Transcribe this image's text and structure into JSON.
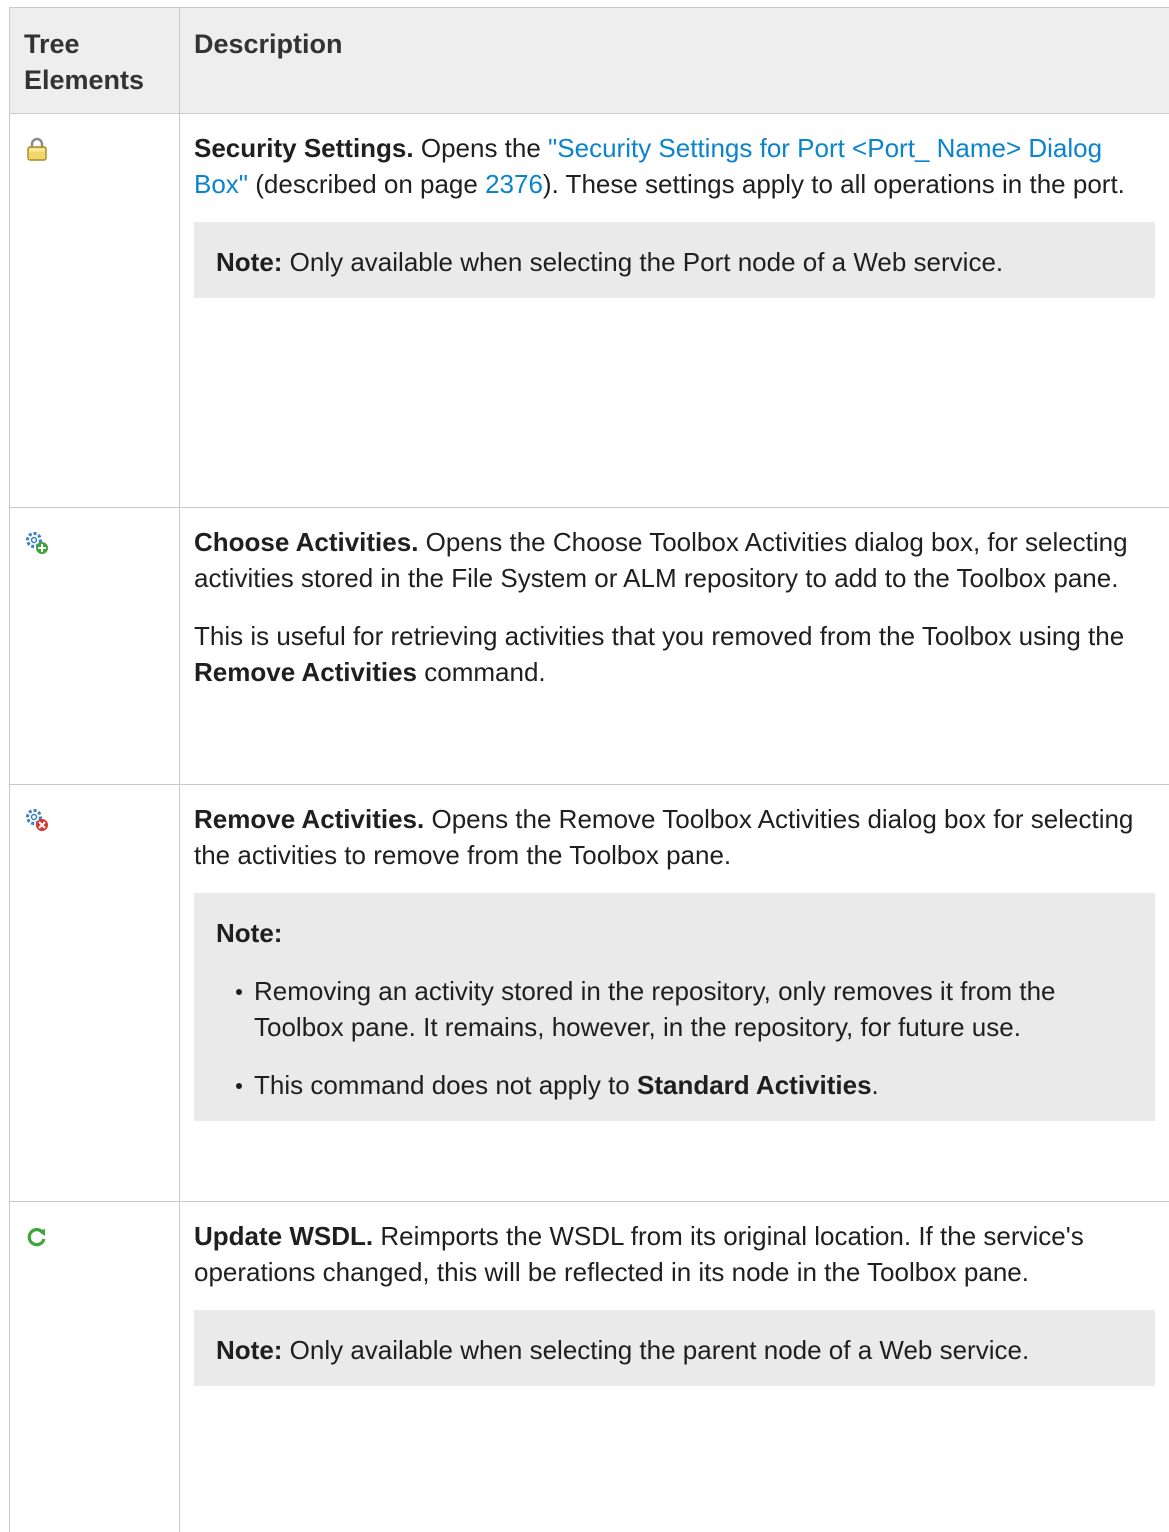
{
  "header": {
    "col1": "Tree Elements",
    "col2": "Description"
  },
  "rows": [
    {
      "icon": "lock-icon",
      "title": "Security Settings.",
      "text1": " Opens the ",
      "link1": "\"Security Settings for Port <Port_ Name> Dialog Box\"",
      "text2": " (described on page ",
      "link2": "2376",
      "text3": "). These settings apply to all operations in the port.",
      "note_label": "Note:",
      "note_text": " Only available when selecting the Port node of a Web service."
    },
    {
      "icon": "gear-add-icon",
      "title": "Choose Activities.",
      "text1": " Opens the Choose Toolbox Activities dialog box, for selecting activities stored in the File System or ALM repository to add to the Toolbox pane.",
      "para2_a": "This is useful for retrieving activities that you removed from the Toolbox using the ",
      "para2_b": "Remove Activities",
      "para2_c": " command."
    },
    {
      "icon": "gear-remove-icon",
      "title": "Remove Activities.",
      "text1": " Opens the Remove Toolbox Activities dialog box for selecting the activities to remove from the Toolbox pane.",
      "note_label": "Note:",
      "bullet1": "Removing an activity stored in the repository, only removes it from the Toolbox pane. It remains, however, in the repository, for future use.",
      "bullet2_a": "This command does not apply to ",
      "bullet2_b": "Standard Activities",
      "bullet2_c": "."
    },
    {
      "icon": "refresh-icon",
      "title": "Update WSDL.",
      "text1": " Reimports the WSDL from its original location. If the service's operations changed, this will be reflected in its node in the Toolbox pane.",
      "note_label": "Note:",
      "note_text": " Only available when selecting the parent node of a Web service."
    }
  ],
  "colors": {
    "link": "#0a84cc",
    "note_bg": "#eaeaea",
    "header_bg": "#eeeeee"
  }
}
